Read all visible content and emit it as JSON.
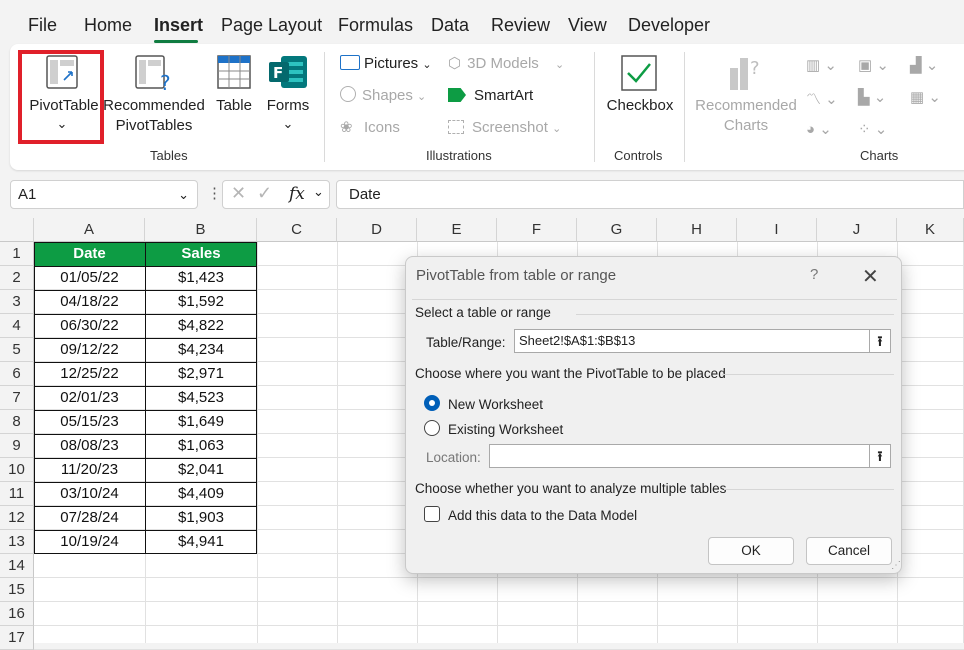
{
  "menu": {
    "items": [
      "File",
      "Home",
      "Insert",
      "Page Layout",
      "Formulas",
      "Data",
      "Review",
      "View",
      "Developer"
    ],
    "active": "Insert"
  },
  "ribbon": {
    "tables": {
      "pivottable": "PivotTable",
      "pivottable_caret": "⌄",
      "recommended_line1": "Recommended",
      "recommended_line2": "PivotTables",
      "table": "Table",
      "forms": "Forms",
      "forms_caret": "⌄",
      "label": "Tables"
    },
    "illustrations": {
      "pictures": "Pictures",
      "shapes": "Shapes",
      "icons": "Icons",
      "models": "3D Models",
      "smartart": "SmartArt",
      "screenshot": "Screenshot",
      "label": "Illustrations"
    },
    "controls": {
      "checkbox": "Checkbox",
      "label": "Controls"
    },
    "charts": {
      "recommended_line1": "Recommended",
      "recommended_line2": "Charts",
      "label": "Charts"
    }
  },
  "formula_bar": {
    "name_box": "A1",
    "fx": "fx",
    "value": "Date"
  },
  "grid": {
    "columns": [
      "A",
      "B",
      "C",
      "D",
      "E",
      "F",
      "G",
      "H",
      "I",
      "J",
      "K"
    ],
    "rows": [
      "1",
      "2",
      "3",
      "4",
      "5",
      "6",
      "7",
      "8",
      "9",
      "10",
      "11",
      "12",
      "13",
      "14",
      "15",
      "16",
      "17"
    ]
  },
  "table": {
    "headers": [
      "Date",
      "Sales"
    ],
    "rows": [
      [
        "01/05/22",
        "$1,423"
      ],
      [
        "04/18/22",
        "$1,592"
      ],
      [
        "06/30/22",
        "$4,822"
      ],
      [
        "09/12/22",
        "$4,234"
      ],
      [
        "12/25/22",
        "$2,971"
      ],
      [
        "02/01/23",
        "$4,523"
      ],
      [
        "05/15/23",
        "$1,649"
      ],
      [
        "08/08/23",
        "$1,063"
      ],
      [
        "11/20/23",
        "$2,041"
      ],
      [
        "03/10/24",
        "$4,409"
      ],
      [
        "07/28/24",
        "$1,903"
      ],
      [
        "10/19/24",
        "$4,941"
      ]
    ]
  },
  "dialog": {
    "title": "PivotTable from table or range",
    "help": "?",
    "close": "✕",
    "select_label": "Select a table or range",
    "range_label": "Table/Range:",
    "range_value": "Sheet2!$A$1:$B$13",
    "placement_label": "Choose where you want the PivotTable to be placed",
    "new_ws": "New Worksheet",
    "existing_ws": "Existing Worksheet",
    "location_label": "Location:",
    "location_value": "",
    "multi_label": "Choose whether you want to analyze multiple tables",
    "data_model": "Add this data to the Data Model",
    "ok": "OK",
    "cancel": "Cancel",
    "selected_option": "New Worksheet",
    "data_model_checked": false
  },
  "colors": {
    "accent": "#107c41",
    "header_fill": "#0d9c44",
    "highlight": "#e0202a",
    "radio": "#005fb8"
  }
}
